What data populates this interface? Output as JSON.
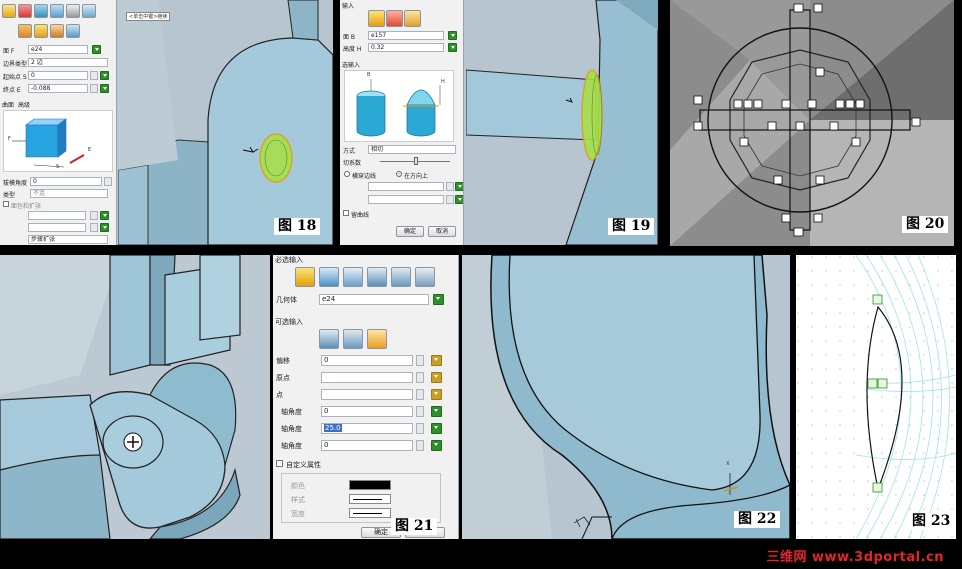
{
  "figures": {
    "f18": "图 18",
    "f19": "图 19",
    "f20": "图 20",
    "f21": "图 21",
    "f22": "图 22",
    "f23": "图 23"
  },
  "fig18": {
    "fields": [
      {
        "label": "面 F",
        "value": "e24"
      },
      {
        "label": "边界类型",
        "value": "2 边"
      },
      {
        "label": "起始点 S",
        "value": "0"
      },
      {
        "label": "终点 E",
        "value": "-0.088"
      }
    ],
    "tabs": [
      "曲面",
      "高级"
    ],
    "preview_labels": {
      "f": "F",
      "e": "E",
      "s": "S"
    },
    "lower": [
      {
        "label": "拔模角度",
        "value": "0"
      },
      {
        "label": "类型",
        "value": "不连"
      },
      {
        "label": "",
        "value": ""
      },
      {
        "label": "",
        "value": ""
      },
      {
        "label": "",
        "value": "步骤扩张"
      }
    ],
    "checkbox_label": "面包和扩张",
    "viewport_tag": "<单击中键>继续"
  },
  "fig19": {
    "header": "输入",
    "fields": [
      {
        "label": "面 B",
        "value": "e157"
      },
      {
        "label": "高度 H",
        "value": "0.32"
      }
    ],
    "sect_optional": "选输入",
    "dim_labels": {
      "b": "B",
      "h": "H"
    },
    "options": [
      {
        "label": "方式",
        "value": "相切"
      },
      {
        "label": "切系数",
        "value": ""
      }
    ],
    "radio": {
      "left": "横穿边线",
      "right": "在方向上"
    },
    "extra_rows": [
      "",
      ""
    ],
    "checkbox_label": "留曲线",
    "buttons": {
      "ok": "确定",
      "cancel": "取消"
    }
  },
  "fig21": {
    "header": "必选输入",
    "geometry_label": "几何体",
    "geometry_value": "e24",
    "optional_header": "可选输入",
    "rows": [
      {
        "label": "偏移",
        "value": "0"
      },
      {
        "label": "原点",
        "value": ""
      },
      {
        "label": "点",
        "value": ""
      },
      {
        "label": "轴角度",
        "value": "0"
      },
      {
        "label": "轴角度",
        "value": "25.0"
      },
      {
        "label": "轴角度",
        "value": "0"
      }
    ],
    "custom_attr": "自定义属性",
    "attr_rows": [
      {
        "label": "颜色"
      },
      {
        "label": "样式"
      },
      {
        "label": "宽度"
      }
    ],
    "buttons": {
      "ok": "确定",
      "cancel": "取消"
    }
  },
  "fig22": {
    "axis_x": "X"
  },
  "watermark": "三维网 www.3dportal.cn",
  "colors": {
    "model": "#9fc6d7",
    "model_dark": "#7ea9bc",
    "panel": "#f1f1f1",
    "accent_green": "#2f8f2a",
    "watermark": "#e3262a"
  }
}
